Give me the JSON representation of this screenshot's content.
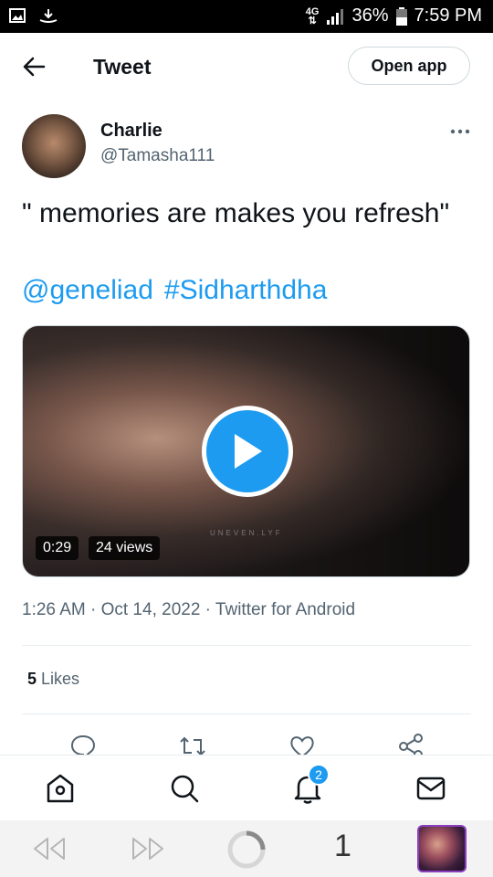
{
  "status_bar": {
    "network": "4G",
    "battery": "36%",
    "time": "7:59 PM",
    "icons": [
      "gallery-icon",
      "download-icon",
      "signal-icon",
      "battery-icon"
    ]
  },
  "header": {
    "title": "Tweet",
    "open_app_label": "Open app",
    "back_icon": "arrow-left-icon"
  },
  "tweet": {
    "author_name": "Charlie",
    "author_handle": "@Tamasha111",
    "text": "\" memories are makes you refresh\"",
    "mention": "@geneliad",
    "hashtag": "#Sidharthdha",
    "video": {
      "duration": "0:29",
      "views": "24 views",
      "watermark": "UNEVEN.LYF"
    },
    "timestamp": "1:26 AM · Oct 14, 2022 · Twitter for Android",
    "likes_count": "5",
    "likes_label": "Likes"
  },
  "actions": [
    "reply-icon",
    "retweet-icon",
    "like-icon",
    "share-icon"
  ],
  "bottom_nav": {
    "items": [
      "home-icon",
      "search-icon",
      "notifications-icon",
      "messages-icon"
    ],
    "notification_badge": "2"
  },
  "browser_bar": {
    "tab_count": "1"
  },
  "colors": {
    "accent": "#1d9bf0",
    "text": "#0f1419",
    "secondary": "#536471",
    "border": "#cfd9de"
  }
}
